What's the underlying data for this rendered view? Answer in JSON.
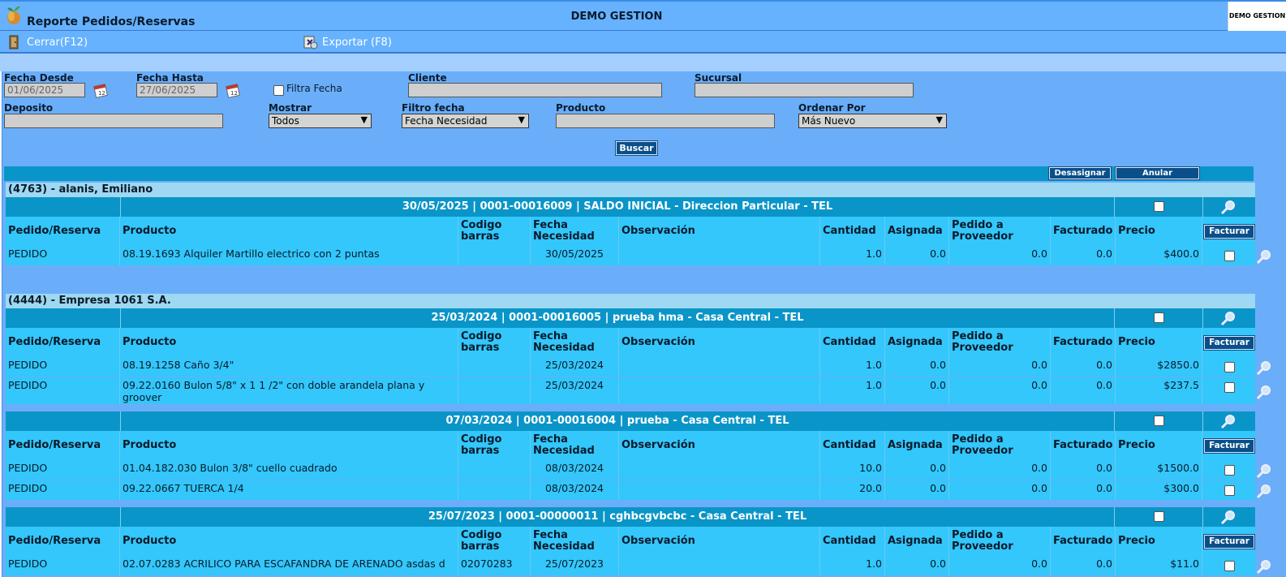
{
  "header": {
    "title": "Reporte Pedidos/Reservas",
    "company": "DEMO GESTION",
    "logo_text": "DEMO GESTION"
  },
  "toolbar": {
    "close_label": "Cerrar(F12)",
    "export_label": "Exportar (F8)"
  },
  "filters": {
    "fecha_desde_label": "Fecha Desde",
    "fecha_desde_value": "01/06/2025",
    "fecha_hasta_label": "Fecha Hasta",
    "fecha_hasta_value": "27/06/2025",
    "filtra_fecha_label": "Filtra Fecha",
    "cliente_label": "Cliente",
    "sucursal_label": "Sucursal",
    "deposito_label": "Deposito",
    "mostrar_label": "Mostrar",
    "mostrar_value": "Todos",
    "filtro_fecha_label": "Filtro fecha",
    "filtro_fecha_value": "Fecha Necesidad",
    "producto_label": "Producto",
    "ordenar_label": "Ordenar Por",
    "ordenar_value": "Más Nuevo",
    "buscar_label": "Buscar"
  },
  "actions": {
    "desasignar_label": "Desasignar",
    "anular_label": "Anular"
  },
  "columns": {
    "pedido": "Pedido/Reserva",
    "producto": "Producto",
    "codigo": "Codigo barras",
    "fecha": "Fecha Necesidad",
    "obs": "Observación",
    "cantidad": "Cantidad",
    "asignada": "Asignada",
    "pedido_prov": "Pedido a Proveedor",
    "facturado": "Facturado",
    "precio": "Precio",
    "facturar": "Facturar"
  },
  "customers": [
    {
      "name": "(4763) - alanis, Emiliano",
      "groups": [
        {
          "title": "30/05/2025 | 0001-00016009 | SALDO INICIAL - Direccion Particular - TEL",
          "rows": [
            {
              "tipo": "PEDIDO",
              "producto": "08.19.1693 Alquiler Martillo electrico con 2 puntas",
              "codigo": "",
              "fecha": "30/05/2025",
              "obs": "",
              "cantidad": "1.0",
              "asignada": "0.0",
              "pedido_prov": "0.0",
              "facturado": "0.0",
              "precio": "$400.0"
            }
          ]
        }
      ]
    },
    {
      "name": "(4444) - Empresa 1061 S.A.",
      "groups": [
        {
          "title": "25/03/2024 | 0001-00016005 | prueba hma - Casa Central - TEL",
          "rows": [
            {
              "tipo": "PEDIDO",
              "producto": "08.19.1258 Caño 3/4\"",
              "codigo": "",
              "fecha": "25/03/2024",
              "obs": "",
              "cantidad": "1.0",
              "asignada": "0.0",
              "pedido_prov": "0.0",
              "facturado": "0.0",
              "precio": "$2850.0"
            },
            {
              "tipo": "PEDIDO",
              "producto": "09.22.0160 Bulon 5/8\" x 1 1 /2\" con doble arandela plana y groover",
              "codigo": "",
              "fecha": "25/03/2024",
              "obs": "",
              "cantidad": "1.0",
              "asignada": "0.0",
              "pedido_prov": "0.0",
              "facturado": "0.0",
              "precio": "$237.5"
            }
          ]
        },
        {
          "title": "07/03/2024 | 0001-00016004 | prueba - Casa Central - TEL",
          "rows": [
            {
              "tipo": "PEDIDO",
              "producto": "01.04.182.030 Bulon 3/8\" cuello cuadrado",
              "codigo": "",
              "fecha": "08/03/2024",
              "obs": "",
              "cantidad": "10.0",
              "asignada": "0.0",
              "pedido_prov": "0.0",
              "facturado": "0.0",
              "precio": "$1500.0"
            },
            {
              "tipo": "PEDIDO",
              "producto": "09.22.0667 TUERCA 1/4",
              "codigo": "",
              "fecha": "08/03/2024",
              "obs": "",
              "cantidad": "20.0",
              "asignada": "0.0",
              "pedido_prov": "0.0",
              "facturado": "0.0",
              "precio": "$300.0"
            }
          ]
        },
        {
          "title": "25/07/2023 | 0001-00000011 | cghbcgvbcbc - Casa Central - TEL",
          "rows": [
            {
              "tipo": "PEDIDO",
              "producto": "02.07.0283 ACRILICO PARA ESCAFANDRA DE ARENADO asdas d",
              "codigo": "02070283",
              "fecha": "25/07/2023",
              "obs": "",
              "cantidad": "1.0",
              "asignada": "0.0",
              "pedido_prov": "0.0",
              "facturado": "0.0",
              "precio": "$11.0"
            }
          ]
        }
      ]
    }
  ]
}
